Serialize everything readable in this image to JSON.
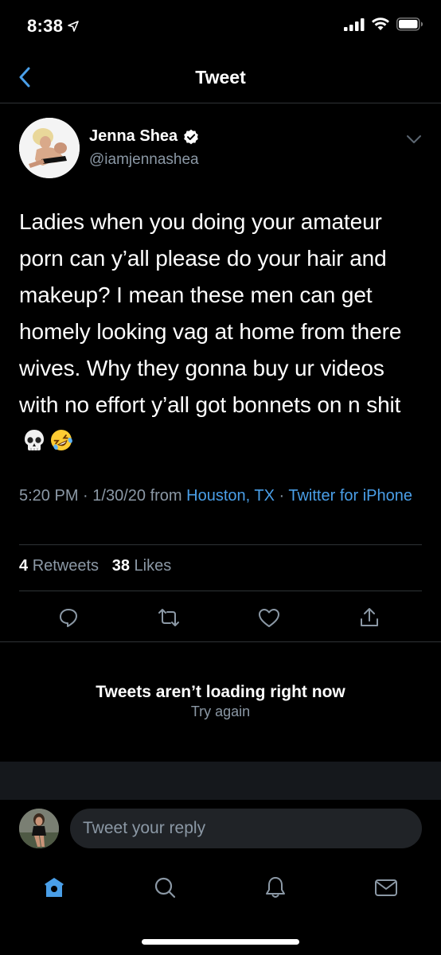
{
  "status_bar": {
    "time": "8:38"
  },
  "nav": {
    "title": "Tweet"
  },
  "tweet": {
    "author_name": "Jenna Shea",
    "author_handle": "@iamjennashea",
    "text": "Ladies when you doing your amateur porn can y’all please do your hair and makeup? I mean these men can get homely looking vag at home from there wives. Why they gonna buy ur videos with no effort y’all got bonnets on n shit",
    "emojis": [
      "skull",
      "rolling-on-the-floor-laughing"
    ],
    "time": "5:20 PM",
    "date": "1/30/20",
    "from_label": "from",
    "location": "Houston, TX",
    "client": "Twitter for iPhone",
    "retweets_count": "4",
    "retweets_label": "Retweets",
    "likes_count": "38",
    "likes_label": "Likes"
  },
  "replies_error": {
    "title": "Tweets aren’t loading right now",
    "retry": "Try again"
  },
  "reply_box": {
    "placeholder": "Tweet your reply"
  },
  "icons": [
    "back-chevron-icon",
    "verified-badge-icon",
    "chevron-down-icon",
    "reply-icon",
    "retweet-icon",
    "like-icon",
    "share-icon",
    "home-icon",
    "search-icon",
    "notifications-icon",
    "messages-icon"
  ],
  "colors": {
    "accent": "#4a9fe8",
    "background": "#000000",
    "secondary_text": "#8b98a5",
    "divider": "#2f3336"
  }
}
